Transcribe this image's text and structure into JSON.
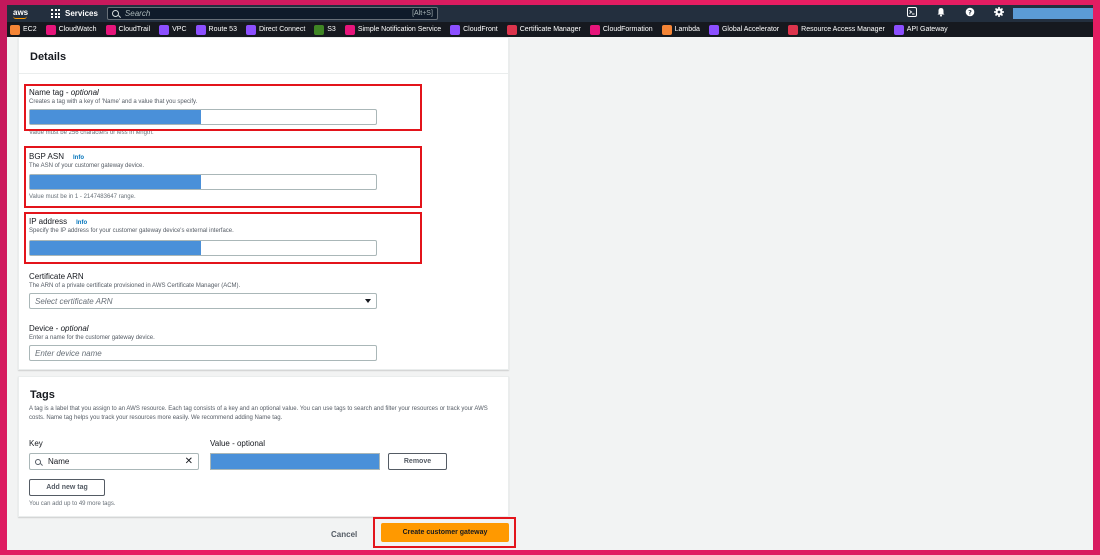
{
  "topnav": {
    "logo_text": "aws",
    "services_label": "Services",
    "search_placeholder": "Search",
    "search_shortcut": "[Alt+S]"
  },
  "favorites": [
    {
      "label": "EC2",
      "color": "#f58536"
    },
    {
      "label": "CloudWatch",
      "color": "#e7157b"
    },
    {
      "label": "CloudTrail",
      "color": "#e7157b"
    },
    {
      "label": "VPC",
      "color": "#8c4fff"
    },
    {
      "label": "Route 53",
      "color": "#8c4fff"
    },
    {
      "label": "Direct Connect",
      "color": "#8c4fff"
    },
    {
      "label": "S3",
      "color": "#3f8624"
    },
    {
      "label": "Simple Notification Service",
      "color": "#e7157b"
    },
    {
      "label": "CloudFront",
      "color": "#8c4fff"
    },
    {
      "label": "Certificate Manager",
      "color": "#dd344c"
    },
    {
      "label": "CloudFormation",
      "color": "#e7157b"
    },
    {
      "label": "Lambda",
      "color": "#f58536"
    },
    {
      "label": "Global Accelerator",
      "color": "#8c4fff"
    },
    {
      "label": "Resource Access Manager",
      "color": "#dd344c"
    },
    {
      "label": "API Gateway",
      "color": "#8c4fff"
    }
  ],
  "details": {
    "title": "Details",
    "name_tag": {
      "label": "Name tag - ",
      "label_opt": "optional",
      "desc": "Creates a tag with a key of 'Name' and a value that you specify.",
      "note": "Value must be 256 characters or less in length."
    },
    "bgp_asn": {
      "label": "BGP ASN",
      "info": "Info",
      "desc": "The ASN of your customer gateway device.",
      "note": "Value must be in 1 - 2147483647 range."
    },
    "ip_address": {
      "label": "IP address",
      "info": "Info",
      "desc": "Specify the IP address for your customer gateway device's external interface."
    },
    "certificate_arn": {
      "label": "Certificate ARN",
      "desc": "The ARN of a private certificate provisioned in AWS Certificate Manager (ACM).",
      "placeholder": "Select certificate ARN"
    },
    "device": {
      "label": "Device - ",
      "label_opt": "optional",
      "desc": "Enter a name for the customer gateway device.",
      "placeholder": "Enter device name"
    }
  },
  "tags": {
    "title": "Tags",
    "desc": "A tag is a label that you assign to an AWS resource. Each tag consists of a key and an optional value. You can use tags to search and filter your resources or track your AWS costs. Name tag helps you track your resources more easily. We recommend adding Name tag.",
    "key_label": "Key",
    "value_label": "Value - optional",
    "key_value": "Name",
    "remove_label": "Remove",
    "add_label": "Add new tag",
    "limit_note": "You can add up to 49 more tags."
  },
  "footer": {
    "cancel_label": "Cancel",
    "create_label": "Create customer gateway"
  }
}
